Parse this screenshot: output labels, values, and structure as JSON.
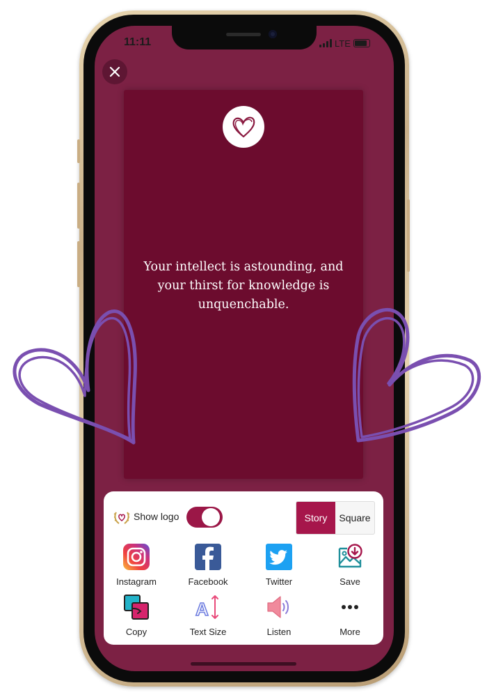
{
  "status_bar": {
    "time": "11:11",
    "network": "LTE"
  },
  "close_icon": "close-icon",
  "card": {
    "quote": "Your intellect is astounding, and your thirst for knowledge is unquenchable.",
    "background": "#6c0c2e",
    "logo_icon": "heart-logo-icon"
  },
  "share_panel": {
    "show_logo_label": "Show logo",
    "show_logo_enabled": true,
    "format_options": [
      "Story",
      "Square"
    ],
    "selected_format": "Story",
    "actions": [
      {
        "label": "Instagram",
        "icon": "instagram-icon"
      },
      {
        "label": "Facebook",
        "icon": "facebook-icon"
      },
      {
        "label": "Twitter",
        "icon": "twitter-icon"
      },
      {
        "label": "Save",
        "icon": "save-icon"
      },
      {
        "label": "Copy",
        "icon": "copy-icon"
      },
      {
        "label": "Text Size",
        "icon": "text-size-icon"
      },
      {
        "label": "Listen",
        "icon": "speaker-icon"
      },
      {
        "label": "More",
        "icon": "more-icon"
      }
    ]
  },
  "colors": {
    "screen_bg": "#7c2144",
    "accent": "#a6164b",
    "doodle": "#7a4fb0"
  }
}
